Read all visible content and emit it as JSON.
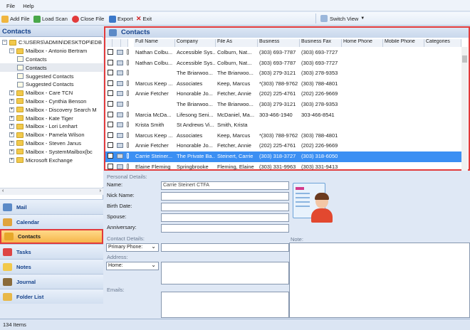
{
  "menu": [
    "File",
    "Help"
  ],
  "toolbar": {
    "add_file": "Add File",
    "load_scan": "Load Scan",
    "close_file": "Close File",
    "export": "Export",
    "exit": "Exit",
    "switch_view": "Switch View"
  },
  "left_pane": {
    "title": "Contacts",
    "tree": [
      {
        "label": "C:\\USERS\\ADMIN\\DESKTOP\\EDB",
        "toggle": "−"
      },
      {
        "label": "Mailbox - Antonio Bertram",
        "toggle": "−"
      },
      {
        "label": "Contacts",
        "toggle": ""
      },
      {
        "label": "Contacts",
        "toggle": ""
      },
      {
        "label": "Suggested Contacts",
        "toggle": ""
      },
      {
        "label": "Suggested Contacts",
        "toggle": ""
      },
      {
        "label": "Mailbox - Care TCN",
        "toggle": "+"
      },
      {
        "label": "Mailbox - Cynthia Benson",
        "toggle": "+"
      },
      {
        "label": "Mailbox - Discovery Search M",
        "toggle": "+"
      },
      {
        "label": "Mailbox - Kate Tiger",
        "toggle": "+"
      },
      {
        "label": "Mailbox - Lori Lenhart",
        "toggle": "+"
      },
      {
        "label": "Mailbox - Pamela Wilson",
        "toggle": "+"
      },
      {
        "label": "Mailbox - Steven Janus",
        "toggle": "+"
      },
      {
        "label": "Mailbox - SystemMailbox{bc",
        "toggle": "+"
      },
      {
        "label": "Microsoft Exchange",
        "toggle": "+"
      }
    ]
  },
  "nav": [
    "Mail",
    "Calendar",
    "Contacts",
    "Tasks",
    "Notes",
    "Journal",
    "Folder List"
  ],
  "grid": {
    "title": "Contacts",
    "columns": [
      "Full Name",
      "Company",
      "File As",
      "Business",
      "Business Fax",
      "Home Phone",
      "Mobile Phone",
      "Categories"
    ],
    "rows": [
      [
        "Nathan Colbu...",
        "Accessible Sys...",
        "Colburn, Nat...",
        "(303) 693-7787",
        "(303) 693-7727",
        "",
        "",
        ""
      ],
      [
        "Nathan Colbu...",
        "Accessible Sys...",
        "Colburn, Nat...",
        "(303) 693-7787",
        "(303) 693-7727",
        "",
        "",
        ""
      ],
      [
        "",
        "The Briarwoo...",
        "The Briarwoo...",
        "(303) 279-3121",
        "(303) 278-9353",
        "",
        "",
        ""
      ],
      [
        "Marcus Keep ...",
        "Associates",
        "Keep, Marcus",
        "*(303) 788-9762",
        "(303) 788-4801",
        "",
        "",
        ""
      ],
      [
        "Annie Fetcher",
        "Honorable Jo...",
        "Fetcher, Annie",
        "(202) 225-4761",
        "(202) 226-9669",
        "",
        "",
        ""
      ],
      [
        "",
        "The Briarwoo...",
        "The Briarwoo...",
        "(303) 279-3121",
        "(303) 278-9353",
        "",
        "",
        ""
      ],
      [
        "Marcia McDa...",
        "Lifesong Seni...",
        "McDaniel, Ma...",
        "303-466-1940",
        "303-466-8541",
        "",
        "",
        ""
      ],
      [
        "Krista Smith",
        "St Andrews Vi...",
        "Smith, Krista",
        "",
        "",
        "",
        "",
        ""
      ],
      [
        "Marcus Keep ...",
        "Associates",
        "Keep, Marcus",
        "*(303) 788-9762",
        "(303) 788-4801",
        "",
        "",
        ""
      ],
      [
        "Annie Fetcher",
        "Honorable Jo...",
        "Fetcher, Annie",
        "(202) 225-4761",
        "(202) 226-9669",
        "",
        "",
        ""
      ],
      [
        "Carrie Steiner...",
        "The Private Ba...",
        "Steinert, Carrie",
        "(303) 318-3727",
        "(303) 318-6050",
        "",
        "",
        ""
      ],
      [
        "Elaine Fleming",
        "Springbrooke",
        "Fleming, Elaine",
        "(303) 331-9963",
        "(303) 331-9413",
        "",
        "",
        ""
      ]
    ],
    "selected_index": 10
  },
  "detail": {
    "personal_section": "Personal Details:",
    "name_label": "Name:",
    "name_value": "Carrie Steinert CTFA",
    "nickname_label": "Nick Name:",
    "birthdate_label": "Birth Date:",
    "spouse_label": "Spouse:",
    "anniversary_label": "Anniversary:",
    "contact_section": "Contact Details:",
    "primary_phone": "Primary Phone:",
    "address_section": "Address:",
    "address_type": "Home:",
    "emails_label": "Emails:",
    "note_label": "Note:"
  },
  "status": {
    "items": "134 Items"
  }
}
